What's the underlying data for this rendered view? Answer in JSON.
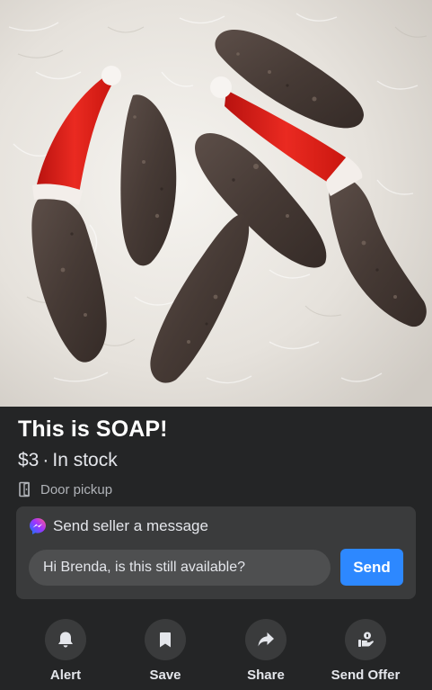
{
  "listing": {
    "title": "This is SOAP!",
    "price": "$3",
    "separator": "·",
    "availability": "In stock",
    "pickup": "Door pickup",
    "pickup_icon": "door-icon"
  },
  "message": {
    "header": "Send seller a message",
    "header_icon": "messenger-icon",
    "input_value": "Hi Brenda, is this still available?",
    "send_label": "Send"
  },
  "actions": [
    {
      "label": "Alert",
      "icon": "bell-icon"
    },
    {
      "label": "Save",
      "icon": "bookmark-icon"
    },
    {
      "label": "Share",
      "icon": "share-arrow-icon"
    },
    {
      "label": "Send Offer",
      "icon": "offer-hand-icon"
    }
  ],
  "colors": {
    "background": "#242526",
    "card": "#3a3b3c",
    "accent": "#2d88ff",
    "santa_hat_red": "#e0201b",
    "soap_brown": "#4a3d38"
  }
}
